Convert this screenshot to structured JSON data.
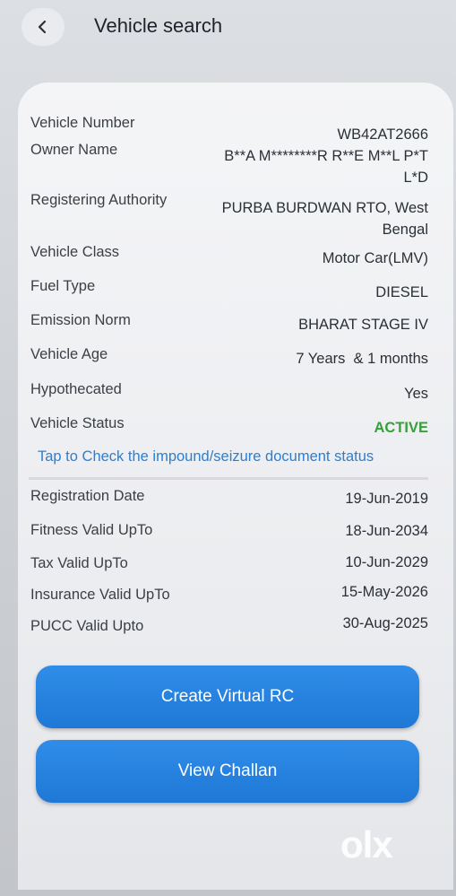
{
  "header": {
    "title": "Vehicle search",
    "back_icon": "chevron-left-icon"
  },
  "details": [
    {
      "label": "Vehicle Number",
      "value": "WB42AT2666"
    },
    {
      "label": "Owner Name",
      "value": "B**A M********R R**E M**L P*T L*D"
    },
    {
      "label": "Registering Authority",
      "value": "PURBA BURDWAN RTO, West Bengal"
    },
    {
      "label": "Vehicle Class",
      "value": "Motor Car(LMV)"
    },
    {
      "label": "Fuel Type",
      "value": "DIESEL"
    },
    {
      "label": "Emission Norm",
      "value": "BHARAT STAGE IV"
    },
    {
      "label": "Vehicle Age",
      "value": "7 Years  & 1 months"
    },
    {
      "label": "Hypothecated",
      "value": "Yes"
    },
    {
      "label": "Vehicle Status",
      "value": "ACTIVE"
    }
  ],
  "impound_link": "Tap to Check the impound/seizure document status",
  "dates": [
    {
      "label": "Registration Date",
      "value": "19-Jun-2019"
    },
    {
      "label": "Fitness Valid UpTo",
      "value": "18-Jun-2034"
    },
    {
      "label": "Tax Valid UpTo",
      "value": "10-Jun-2029"
    },
    {
      "label": "Insurance Valid UpTo",
      "value": "15-May-2026"
    },
    {
      "label": "PUCC Valid Upto",
      "value": "30-Aug-2025"
    }
  ],
  "buttons": {
    "create_rc": "Create Virtual RC",
    "view_challan": "View Challan"
  },
  "watermark": "olx",
  "colors": {
    "accent": "#1f78d6",
    "active": "#37a03a",
    "link": "#2a7fd4"
  }
}
